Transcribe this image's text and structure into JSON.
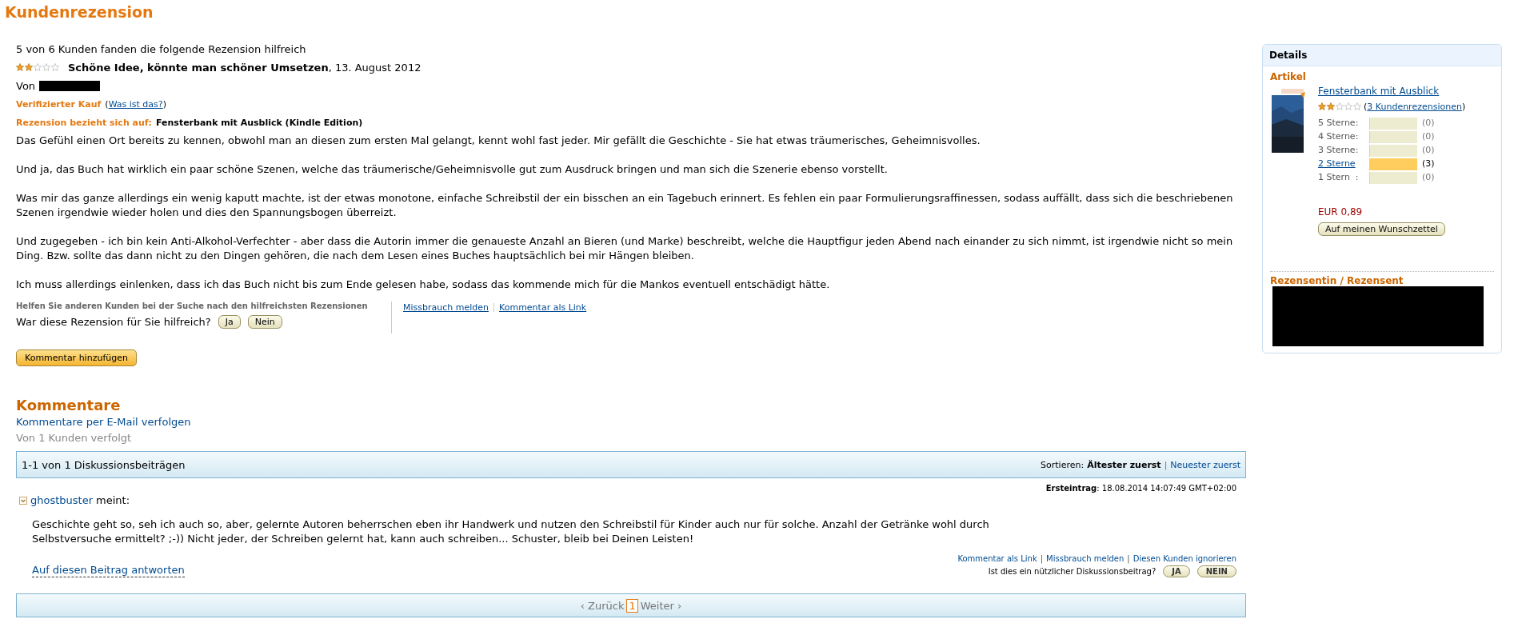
{
  "page_title": "Kundenrezension",
  "review": {
    "helpful_summary": "5 von 6 Kunden fanden die folgende Rezension hilfreich",
    "stars": 2,
    "title": "Schöne Idee, könnte man schöner Umsetzen",
    "date": ", 13. August 2012",
    "by_label": "Von",
    "verified_label": "Verifizierter Kauf",
    "verified_link_prefix": "(",
    "verified_link": "Was ist das?",
    "verified_link_suffix": ")",
    "refers_label": "Rezension bezieht sich auf:",
    "refers_item": "Fensterbank mit Ausblick (Kindle Edition)",
    "paragraphs": [
      "Das Gefühl einen Ort bereits zu kennen, obwohl man an diesen zum ersten Mal gelangt, kennt wohl fast jeder. Mir gefällt die Geschichte - Sie hat etwas träumerisches, Geheimnisvolles.",
      "Und ja, das Buch hat wirklich ein paar schöne Szenen, welche das träumerische/Geheimnisvolle gut zum Ausdruck bringen und man sich die Szenerie ebenso vorstellt.",
      "Was mir das ganze allerdings ein wenig kaputt machte, ist der etwas monotone, einfache Schreibstil der ein bisschen an ein Tagebuch erinnert. Es fehlen ein paar Formulierungsraffinessen, sodass auffällt, dass sich die beschriebenen Szenen irgendwie wieder holen und dies den Spannungsbogen überreizt.",
      "Und zugegeben - ich bin kein Anti-Alkohol-Verfechter - aber dass die Autorin immer die genaueste Anzahl an Bieren (und Marke) beschreibt, welche die Hauptfigur jeden Abend nach einander zu sich nimmt, ist irgendwie nicht so mein Ding. Bzw. sollte das dann nicht zu den Dingen gehören, die nach dem Lesen eines Buches hauptsächlich bei mir Hängen bleiben.",
      "Ich muss allerdings einlenken, dass ich das Buch nicht bis zum Ende gelesen habe, sodass das kommende mich für die Mankos eventuell entschädigt hätte."
    ],
    "help_hint": "Helfen Sie anderen Kunden bei der Suche nach den hilfreichsten Rezensionen",
    "helpful_question": "War diese Rezension für Sie hilfreich?",
    "vote_buttons": [
      "Ja",
      "Nein"
    ],
    "links": [
      "Missbrauch melden",
      "Kommentar als Link"
    ],
    "add_comment_button": "Kommentar hinzufügen"
  },
  "comments": {
    "heading": "Kommentare",
    "follow_link": "Kommentare per E-Mail verfolgen",
    "followers": "Von 1 Kunden verfolgt",
    "count_label": "1-1 von 1 Diskussionsbeiträgen",
    "sort_label": "Sortieren:",
    "separator": "|",
    "sort_options": [
      {
        "label": "Ältester zuerst",
        "selected": true
      },
      {
        "label": "Neuester zuerst",
        "selected": false
      }
    ],
    "posts": [
      {
        "first_entry_label": "Ersteintrag",
        "first_entry_date": ": 18.08.2014 14:07:49 GMT+02:00",
        "author": "ghostbuster",
        "says": "meint:",
        "text": "Geschichte geht so, seh ich auch so, aber, gelernte Autoren beherrschen eben ihr Handwerk und nutzen den Schreibstil für Kinder auch nur für solche. Anzahl der Getränke wohl durch Selbstversuche ermittelt? ;-)) Nicht jeder, der Schreiben gelernt hat, kann auch schreiben... Schuster, bleib bei Deinen Leisten!",
        "reply_link": "Auf diesen Beitrag antworten",
        "links": [
          "Kommentar als Link",
          "Missbrauch melden",
          "Diesen Kunden ignorieren"
        ],
        "useful_question": "Ist dies ein nützlicher Diskussionsbeitrag?",
        "vote_buttons": [
          "JA",
          "NEIN"
        ]
      }
    ],
    "pagination": {
      "prev": "‹ Zurück",
      "pages": [
        {
          "label": "1",
          "selected": true
        }
      ],
      "next": "Weiter ›"
    }
  },
  "sidebar": {
    "title": "Details",
    "article_heading": "Artikel",
    "book_title": "Fensterbank mit Ausblick",
    "stars": 2,
    "reviews_link_prefix": "(",
    "reviews_link": "3 Kundenrezensionen",
    "reviews_link_suffix": ")",
    "rating_rows": [
      {
        "label": "5 Sterne:",
        "count": "(0)",
        "level": 0,
        "linked": false
      },
      {
        "label": "4 Sterne:",
        "count": "(0)",
        "level": 0,
        "linked": false
      },
      {
        "label": "3 Sterne:",
        "count": "(0)",
        "level": 0,
        "linked": false
      },
      {
        "label": "2 Sterne",
        "count": "(3)",
        "level": 1,
        "linked": true
      },
      {
        "label": "1 Stern  :",
        "count": "(0)",
        "level": 0,
        "linked": false
      }
    ],
    "price": "EUR 0,89",
    "wishlist_button": "Auf meinen Wunschzettel",
    "reviewer_heading": "Rezensentin / Rezensent"
  }
}
